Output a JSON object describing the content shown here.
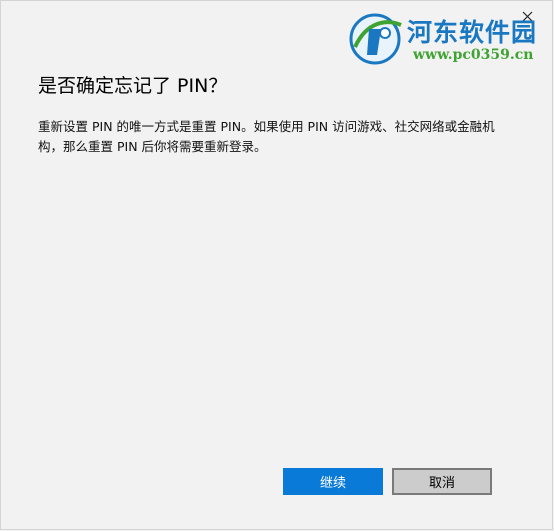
{
  "dialog": {
    "title": "是否确定忘记了 PIN？",
    "description": "重新设置 PIN 的唯一方式是重置 PIN。如果使用 PIN 访问游戏、社交网络或金融机构，那么重置 PIN 后你将需要重新登录。",
    "continue_label": "继续",
    "cancel_label": "取消"
  },
  "watermark": {
    "site_name": "河东软件园",
    "url": "www.pc0359.cn"
  },
  "colors": {
    "primary": "#0a7ad8",
    "background": "#f2f2f2",
    "watermark_blue": "#1a78c2",
    "watermark_green": "#3fa332"
  },
  "icons": {
    "close": "close-icon",
    "logo": "site-logo-icon"
  }
}
